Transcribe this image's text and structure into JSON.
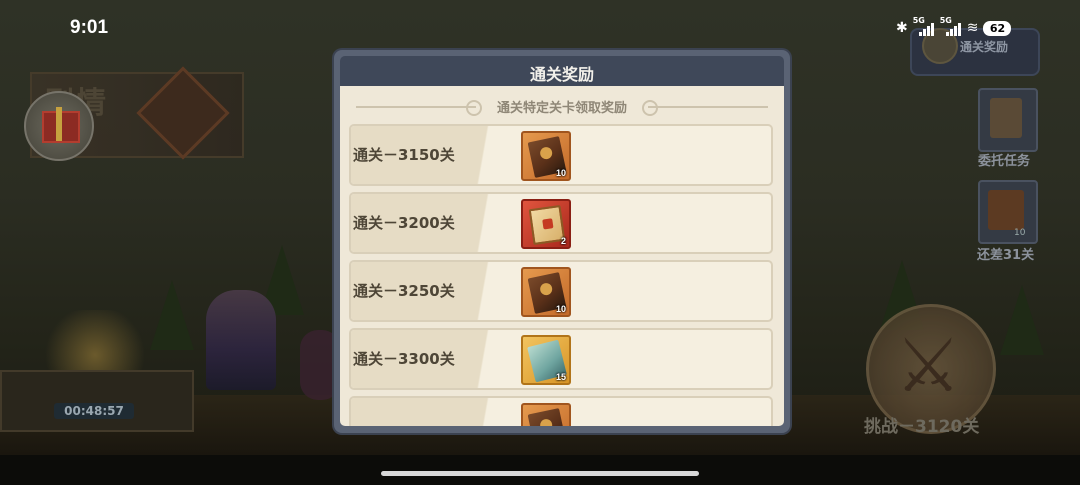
{
  "status_bar": {
    "time": "9:01",
    "network_a": "5G",
    "network_b": "5G",
    "battery": "62",
    "icons": [
      "bluetooth-icon",
      "signal-icon",
      "signal-icon",
      "wifi-icon",
      "battery-icon"
    ]
  },
  "background": {
    "story_label": "剧情",
    "timer": "00:48:57",
    "hud_reward_label": "通关奖励",
    "hud_task_label": "委托任务",
    "hud_book_count": "10",
    "hud_remaining_label": "还差31关",
    "challenge_label": "挑战－3120关"
  },
  "modal": {
    "title": "通关奖励",
    "subtitle": "通关特定关卡领取奖励",
    "rows": [
      {
        "label": "通关－3150关",
        "item_icon": "skill-book-icon",
        "slot_color": "#d9833f",
        "count": "10"
      },
      {
        "label": "通关－3200关",
        "item_icon": "treasure-chest-icon",
        "slot_color": "#c9412f",
        "count": "2"
      },
      {
        "label": "通关－3250关",
        "item_icon": "skill-book-icon",
        "slot_color": "#d9833f",
        "count": "10"
      },
      {
        "label": "通关－3300关",
        "item_icon": "scroll-icon",
        "slot_color": "#e6b04a",
        "count": "15"
      },
      {
        "label": "",
        "item_icon": "skill-book-icon",
        "slot_color": "#d9833f",
        "count": ""
      }
    ]
  },
  "colors": {
    "modal_frame": "#5a6374",
    "modal_header": "#3f4859",
    "modal_body": "#efe8d8",
    "label_text": "#4e4637"
  }
}
